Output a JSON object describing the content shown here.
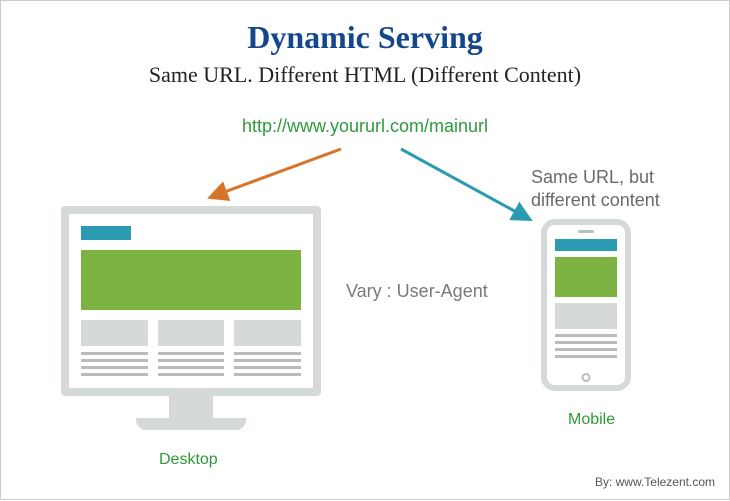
{
  "title": "Dynamic Serving",
  "subtitle": "Same URL. Different HTML (Different Content)",
  "url": "http://www.yoururl.com/mainurl",
  "vary_label": "Vary : User-Agent",
  "note_line1": "Same URL, but",
  "note_line2": "different content",
  "desktop_label": "Desktop",
  "mobile_label": "Mobile",
  "attribution_prefix": "By: ",
  "attribution_site": "www.Telezent.com",
  "colors": {
    "title": "#14468c",
    "accent_green": "#2e9b3a",
    "teal": "#2a9bb0",
    "bar_green": "#7cb342",
    "device_gray": "#d6d9da",
    "arrow_orange": "#d8732a"
  }
}
